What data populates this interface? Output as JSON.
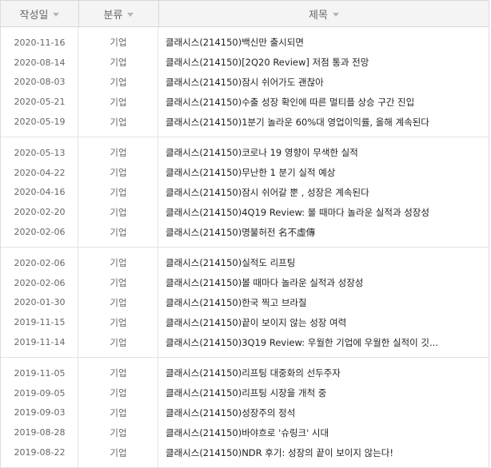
{
  "header": {
    "date_label": "작성일",
    "category_label": "분류",
    "title_label": "제목"
  },
  "groups": [
    {
      "rows": [
        {
          "date": "2020-11-16",
          "category": "기업",
          "title": "클래시스(214150)백신만 출시되면"
        },
        {
          "date": "2020-08-14",
          "category": "기업",
          "title": "클래시스(214150)[2Q20 Review] 저점 통과 전망"
        },
        {
          "date": "2020-08-03",
          "category": "기업",
          "title": "클래시스(214150)잠시 쉬어가도 괜찮아"
        },
        {
          "date": "2020-05-21",
          "category": "기업",
          "title": "클래시스(214150)수출 성장 확인에 따른 멀티플 상승 구간 진입"
        },
        {
          "date": "2020-05-19",
          "category": "기업",
          "title": "클래시스(214150)1분기 놀라운 60%대 영업이익률, 올해 계속된다"
        }
      ]
    },
    {
      "rows": [
        {
          "date": "2020-05-13",
          "category": "기업",
          "title": "클래시스(214150)코로나 19 영향이 무색한 실적"
        },
        {
          "date": "2020-04-22",
          "category": "기업",
          "title": "클래시스(214150)무난한 1 분기 실적 예상"
        },
        {
          "date": "2020-04-16",
          "category": "기업",
          "title": "클래시스(214150)잠시 쉬어갈 뿐 , 성장은 계속된다"
        },
        {
          "date": "2020-02-20",
          "category": "기업",
          "title": "클래시스(214150)4Q19 Review: 볼 때마다 놀라운 실적과 성장성"
        },
        {
          "date": "2020-02-06",
          "category": "기업",
          "title": "클래시스(214150)명불허전 名不虛傳"
        }
      ]
    },
    {
      "rows": [
        {
          "date": "2020-02-06",
          "category": "기업",
          "title": "클래시스(214150)실적도 리프팅"
        },
        {
          "date": "2020-02-06",
          "category": "기업",
          "title": "클래시스(214150)볼 때마다 놀라운 실적과 성장성"
        },
        {
          "date": "2020-01-30",
          "category": "기업",
          "title": "클래시스(214150)한국 찍고 브라질"
        },
        {
          "date": "2019-11-15",
          "category": "기업",
          "title": "클래시스(214150)끝이 보이지 않는 성장 여력"
        },
        {
          "date": "2019-11-14",
          "category": "기업",
          "title": "클래시스(214150)3Q19 Review: 우월한 기업에 우월한 실적이 깃..."
        }
      ]
    },
    {
      "rows": [
        {
          "date": "2019-11-05",
          "category": "기업",
          "title": "클래시스(214150)리프팅 대중화의 선두주자"
        },
        {
          "date": "2019-09-05",
          "category": "기업",
          "title": "클래시스(214150)리프팅 시장을 개척 중"
        },
        {
          "date": "2019-09-03",
          "category": "기업",
          "title": "클래시스(214150)성장주의 정석"
        },
        {
          "date": "2019-08-28",
          "category": "기업",
          "title": "클래시스(214150)바야흐로 '슈링크' 시대"
        },
        {
          "date": "2019-08-22",
          "category": "기업",
          "title": "클래시스(214150)NDR 후기: 성장의 끝이 보이지 않는다!"
        }
      ]
    }
  ]
}
